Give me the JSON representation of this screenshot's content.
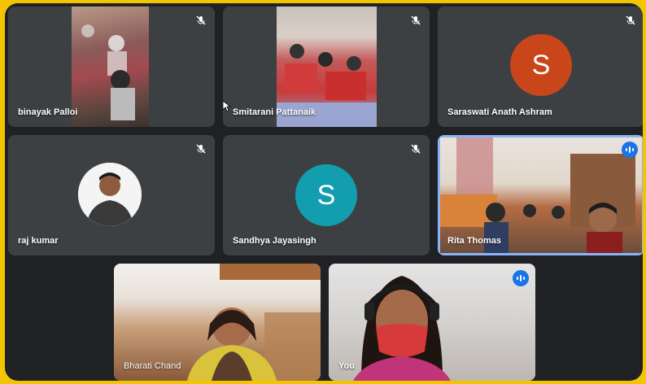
{
  "participants": [
    {
      "name": "binayak Palloi",
      "muted": true
    },
    {
      "name": "Smitarani Pattanaik",
      "muted": true
    },
    {
      "name": "Saraswati Anath Ashram",
      "muted": true,
      "initial": "S",
      "avatar_color": "#c8461a"
    },
    {
      "name": "raj kumar",
      "muted": true
    },
    {
      "name": "Sandhya Jayasingh",
      "muted": true,
      "initial": "S",
      "avatar_color": "#129eaf"
    },
    {
      "name": "Rita Thomas",
      "speaking": true
    },
    {
      "name": "Bharati Chand"
    },
    {
      "name": "You",
      "speaking": true
    }
  ],
  "colors": {
    "frame": "#f2c500",
    "stage": "#202124",
    "tile": "#3c4043",
    "speaking_indicator": "#1a73e8",
    "active_border": "#8ab4f8"
  },
  "icons": {
    "muted": "mic-off-icon",
    "speaking": "audio-level-icon",
    "pointer": "mouse-cursor-icon"
  }
}
